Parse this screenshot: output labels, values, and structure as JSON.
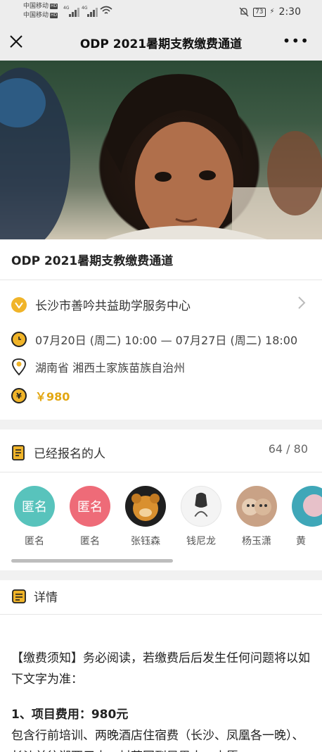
{
  "status": {
    "carrier1": "中国移动",
    "carrier2": "中国移动",
    "hd": "HD",
    "net": "4G",
    "battery": "73",
    "time": "2:30"
  },
  "nav": {
    "title": "ODP 2021暑期支教缴费通道"
  },
  "event": {
    "title": "ODP 2021暑期支教缴费通道",
    "organizer": "长沙市善吟共益助学服务中心",
    "time": "07月20日 (周二) 10:00 — 07月27日 (周二) 18:00",
    "location": "湖南省 湘西土家族苗族自治州",
    "price": "￥980"
  },
  "registrants": {
    "label": "已经报名的人",
    "count": "64 / 80",
    "people": [
      {
        "name": "匿名",
        "avatar_text": "匿名",
        "color": "#58c3bc"
      },
      {
        "name": "匿名",
        "avatar_text": "匿名",
        "color": "#ee6b78"
      },
      {
        "name": "张钰森",
        "avatar_text": "",
        "color": "#1f1f1f"
      },
      {
        "name": "钱尼龙",
        "avatar_text": "",
        "color": "#f4f4f4"
      },
      {
        "name": "杨玉潇",
        "avatar_text": "",
        "color": "#c9a286"
      },
      {
        "name": "黄",
        "avatar_text": "",
        "color": "#3fa7b8"
      }
    ]
  },
  "details": {
    "label": "详情",
    "notice": "【缴费须知】务必阅读，若缴费后后发生任何问题将以如下文字为准：",
    "item1_heading": "1、项目费用：980元",
    "item1_body": "包含行前培训、两晚酒店住宿费（长沙、凤凰各一晚）、长沙前往湘西用大、村落回到凤凰大、支愿"
  },
  "colors": {
    "accent": "#e3a712",
    "icon_yellow": "#f0b429"
  },
  "icons": [
    "close-icon",
    "more-icon",
    "verified-icon",
    "clock-icon",
    "location-icon",
    "yen-icon",
    "signup-list-icon",
    "details-icon",
    "chevron-right-icon"
  ]
}
